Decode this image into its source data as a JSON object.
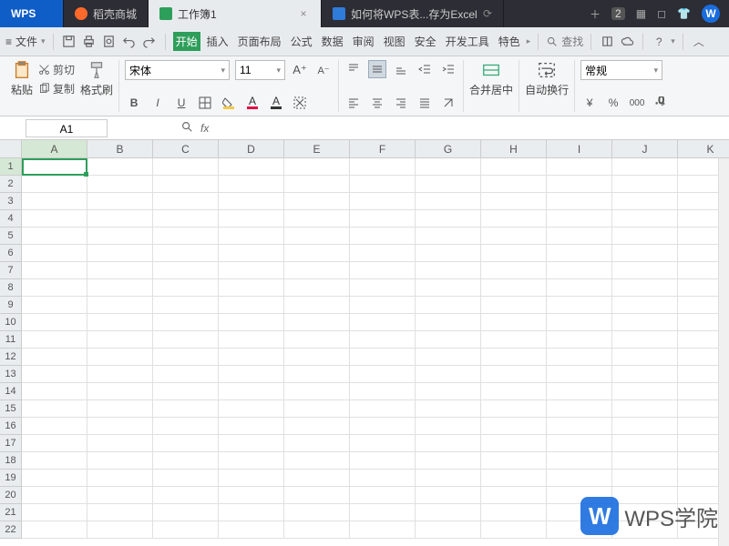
{
  "titlebar": {
    "tabs": [
      {
        "label": "WPS",
        "kind": "wps"
      },
      {
        "label": "稻壳商城",
        "kind": "store",
        "iconColor": "#ff6a2b"
      },
      {
        "label": "工作簿1",
        "kind": "active",
        "iconColor": "#2e9e5b"
      },
      {
        "label": "如何将WPS表...存为Excel",
        "kind": "doc",
        "iconColor": "#2f7bd9"
      }
    ],
    "tabCountBadge": "2",
    "wpsAvatar": "W"
  },
  "menubar": {
    "file": "文件",
    "tabs": [
      "开始",
      "插入",
      "页面布局",
      "公式",
      "数据",
      "审阅",
      "视图",
      "安全",
      "开发工具",
      "特色"
    ],
    "activeTab": 0,
    "search": "查找"
  },
  "ribbon": {
    "paste": "粘贴",
    "cut": "剪切",
    "copy": "复制",
    "format_painter": "格式刷",
    "font_name": "宋体",
    "font_size": "11",
    "merge": "合并居中",
    "wrap": "自动换行",
    "number_format": "常规"
  },
  "namebox": {
    "cell": "A1",
    "fx": "fx"
  },
  "sheet": {
    "columns": [
      "A",
      "B",
      "C",
      "D",
      "E",
      "F",
      "G",
      "H",
      "I",
      "J",
      "K"
    ],
    "rows": [
      "1",
      "2",
      "3",
      "4",
      "5",
      "6",
      "7",
      "8",
      "9",
      "10",
      "11",
      "12",
      "13",
      "14",
      "15",
      "16",
      "17",
      "18",
      "19",
      "20",
      "21",
      "22"
    ],
    "selected": {
      "col": 0,
      "row": 0
    }
  },
  "watermark": {
    "logo": "W",
    "text": "WPS学院"
  }
}
